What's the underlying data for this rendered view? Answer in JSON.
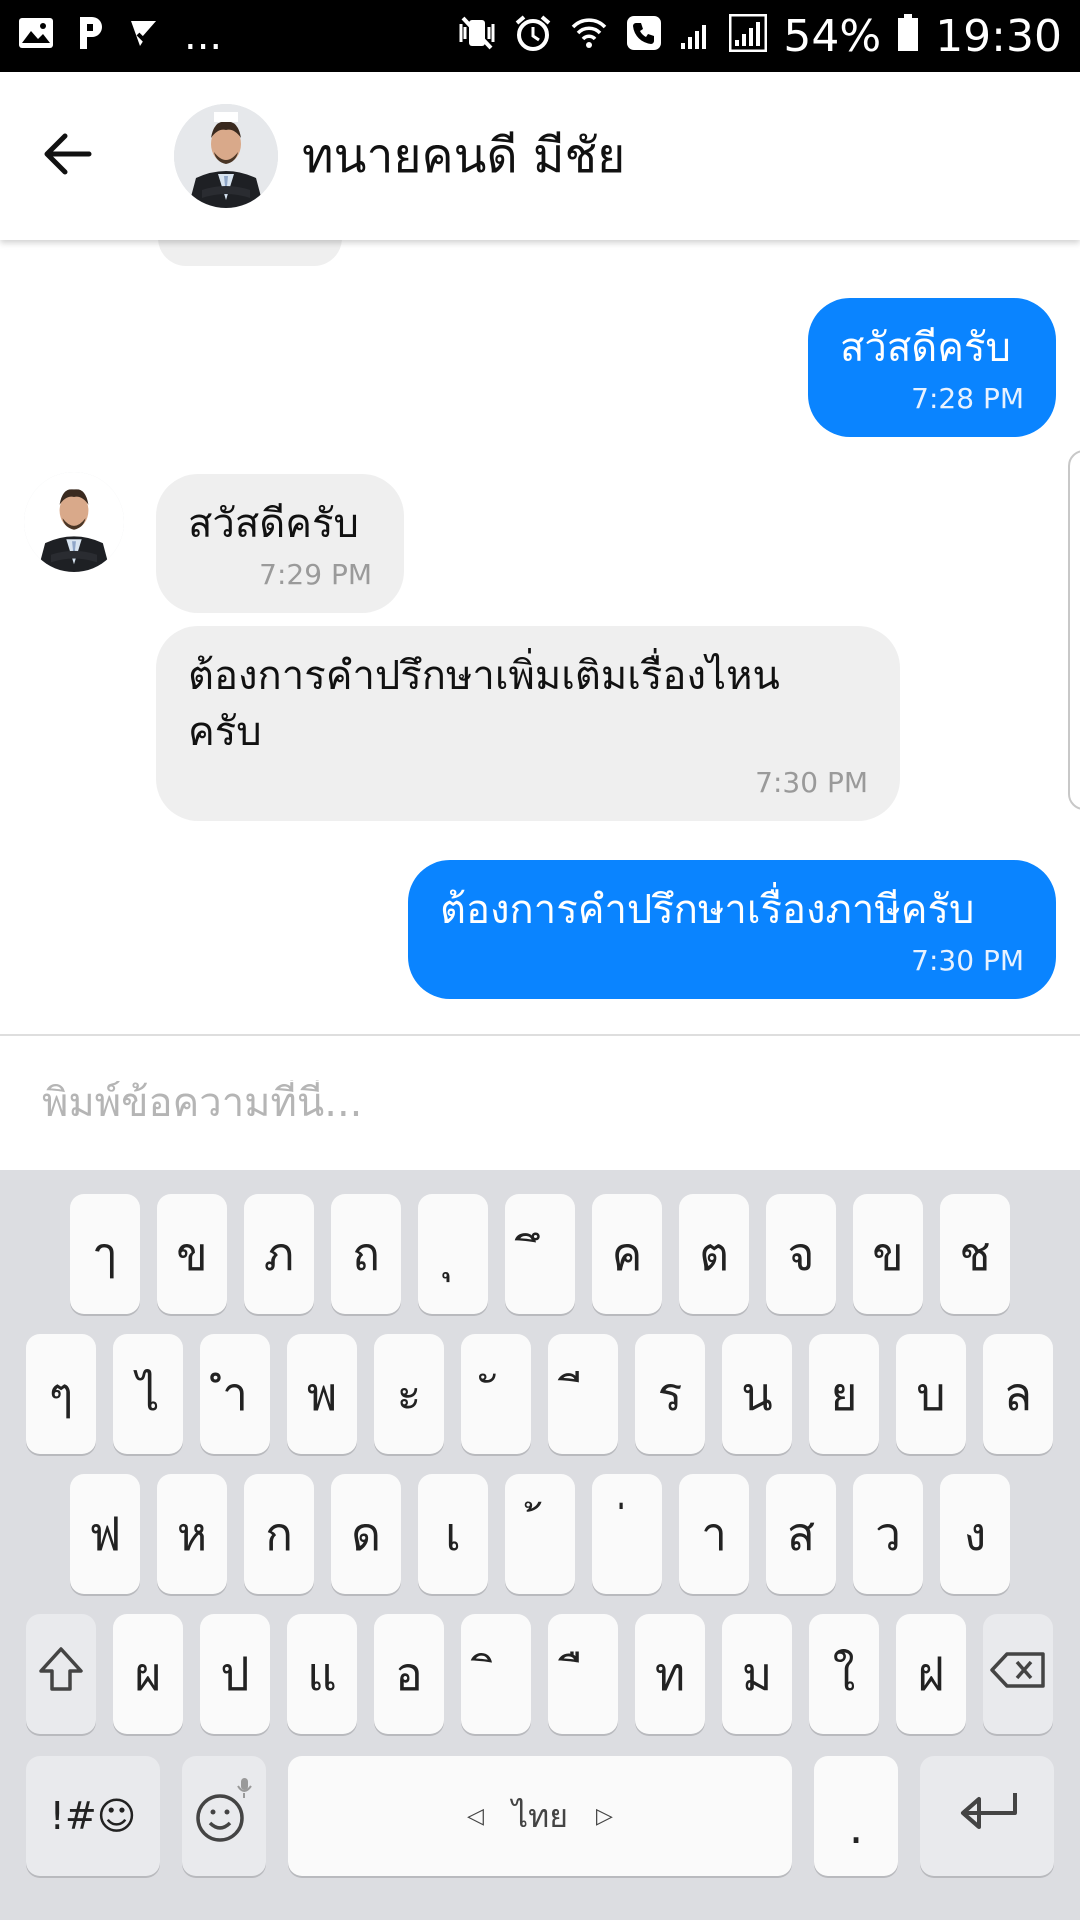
{
  "status_bar": {
    "battery": "54%",
    "time": "19:30",
    "left_extra": "..."
  },
  "header": {
    "contact_name": "ทนายคนดี มีชัย"
  },
  "messages": [
    {
      "direction": "out",
      "text": "สวัสดีครับ",
      "time": "7:28 PM"
    },
    {
      "direction": "in",
      "text": "สวัสดีครับ",
      "time": "7:29 PM"
    },
    {
      "direction": "in",
      "text": "ต้องการคำปรึกษาเพิ่มเติมเรื่องไหน\nครับ",
      "time": "7:30 PM"
    },
    {
      "direction": "out",
      "text": "ต้องการคำปรึกษาเรื่องภาษีครับ",
      "time": "7:30 PM"
    }
  ],
  "composer": {
    "placeholder": "พิมพ์ข้อความที่นี่..."
  },
  "keyboard": {
    "row1": [
      "ๅ",
      "ข",
      "ภ",
      "ถ",
      "ุ",
      "ึ",
      "ค",
      "ต",
      "จ",
      "ข",
      "ช"
    ],
    "row2": [
      "ๆ",
      "ไ",
      "ำ",
      "พ",
      "ะ",
      "ั",
      "ี",
      "ร",
      "น",
      "ย",
      "บ",
      "ล"
    ],
    "row3": [
      "ฟ",
      "ห",
      "ก",
      "ด",
      "เ",
      "้",
      "่",
      "า",
      "ส",
      "ว",
      "ง"
    ],
    "row4": [
      "ผ",
      "ป",
      "แ",
      "อ",
      "ิ",
      "ื",
      "ท",
      "ม",
      "ใ",
      "ฝ"
    ],
    "symbols_label": "!#☺",
    "space_label": "ไทย",
    "period_label": ".",
    "icons": {
      "shift": "shift-icon",
      "backspace": "backspace-icon",
      "emoji": "emoji-icon",
      "enter": "enter-icon"
    }
  },
  "colors": {
    "outgoing_bubble": "#0a84ff",
    "incoming_bubble": "#efefef",
    "keyboard_bg": "#dcdde1"
  }
}
